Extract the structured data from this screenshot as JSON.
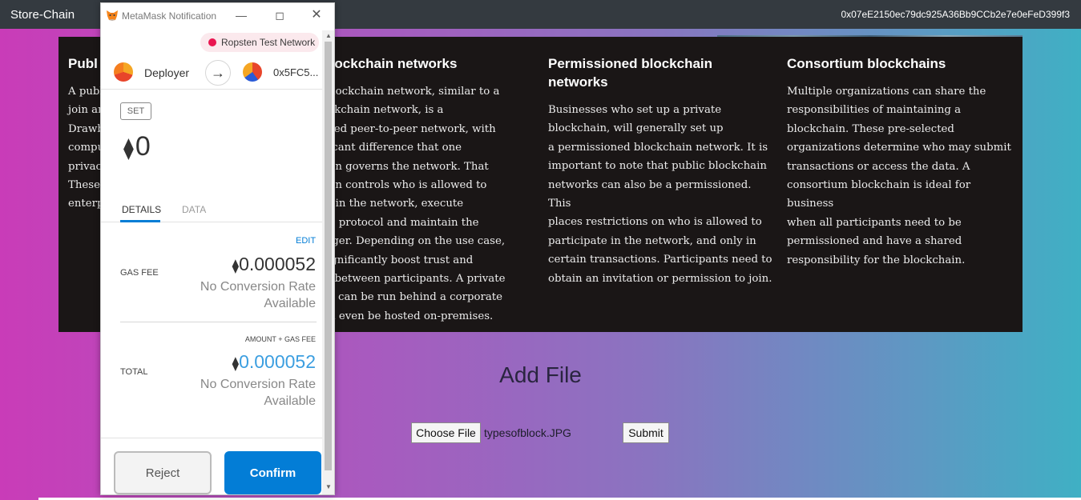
{
  "navbar": {
    "brand": "Store-Chain",
    "account": "0x07eE2150ec79dc925A36Bb9CCb2e7e0eFeD399f3"
  },
  "columns": [
    {
      "title": "Publ",
      "lines": [
        "A publ",
        "join an",
        "Drawb",
        "compu",
        "privac",
        "These",
        "enterp"
      ]
    },
    {
      "title": "ate blockchain networks",
      "lines": [
        "vate blockchain network, similar to a",
        "ic blockchain network, is a",
        "ntralized peer-to-peer network, with",
        "significant difference that one",
        "nization governs the network. That",
        "nization controls who is allowed to",
        "cipate in the network, execute",
        "sensus protocol and maintain the",
        "ed ledger. Depending on the use case,",
        "can significantly boost trust and",
        "dence between participants. A private",
        "kchain can be run behind a corporate",
        "all and even be hosted on-premises."
      ]
    },
    {
      "title": "Permissioned blockchain networks",
      "lines": [
        "Businesses who set up a private",
        "blockchain, will generally set up",
        "a permissioned blockchain network. It is",
        "important to note that public blockchain",
        "networks can also be a permissioned. This",
        "places restrictions on who is allowed to",
        "participate in the network, and only in",
        "certain transactions. Participants need to",
        "obtain an invitation or permission to join."
      ]
    },
    {
      "title": "Consortium blockchains",
      "lines": [
        "Multiple organizations can share the",
        "responsibilities of maintaining a",
        "blockchain. These pre-selected",
        "organizations determine who may submit",
        "transactions or access the data. A",
        "consortium blockchain is ideal for business",
        "when all participants need to be",
        "permissioned and have a shared",
        "responsibility for the blockchain."
      ]
    }
  ],
  "add_file": {
    "title": "Add File",
    "choose_label": "Choose File",
    "file_name": "typesofblock.JPG",
    "submit_label": "Submit"
  },
  "metamask": {
    "window_title": "MetaMask Notification",
    "network": "Ropsten Test Network",
    "from_name": "Deployer",
    "to_address": "0x5FC5...",
    "set_badge": "SET",
    "amount": "0",
    "eth_symbol": "⧫",
    "tabs": {
      "details": "DETAILS",
      "data": "DATA"
    },
    "edit": "EDIT",
    "gas_fee_label": "GAS FEE",
    "gas_fee_value": "0.000052",
    "conversion_line1": "No Conversion Rate",
    "conversion_line2": "Available",
    "amount_gas_label": "AMOUNT + GAS FEE",
    "total_label": "TOTAL",
    "total_value": "0.000052",
    "reject_label": "Reject",
    "confirm_label": "Confirm"
  },
  "colors": {
    "network_dot": "#e91550",
    "confirm": "#037dd6",
    "total_value": "#3b9ee0"
  }
}
